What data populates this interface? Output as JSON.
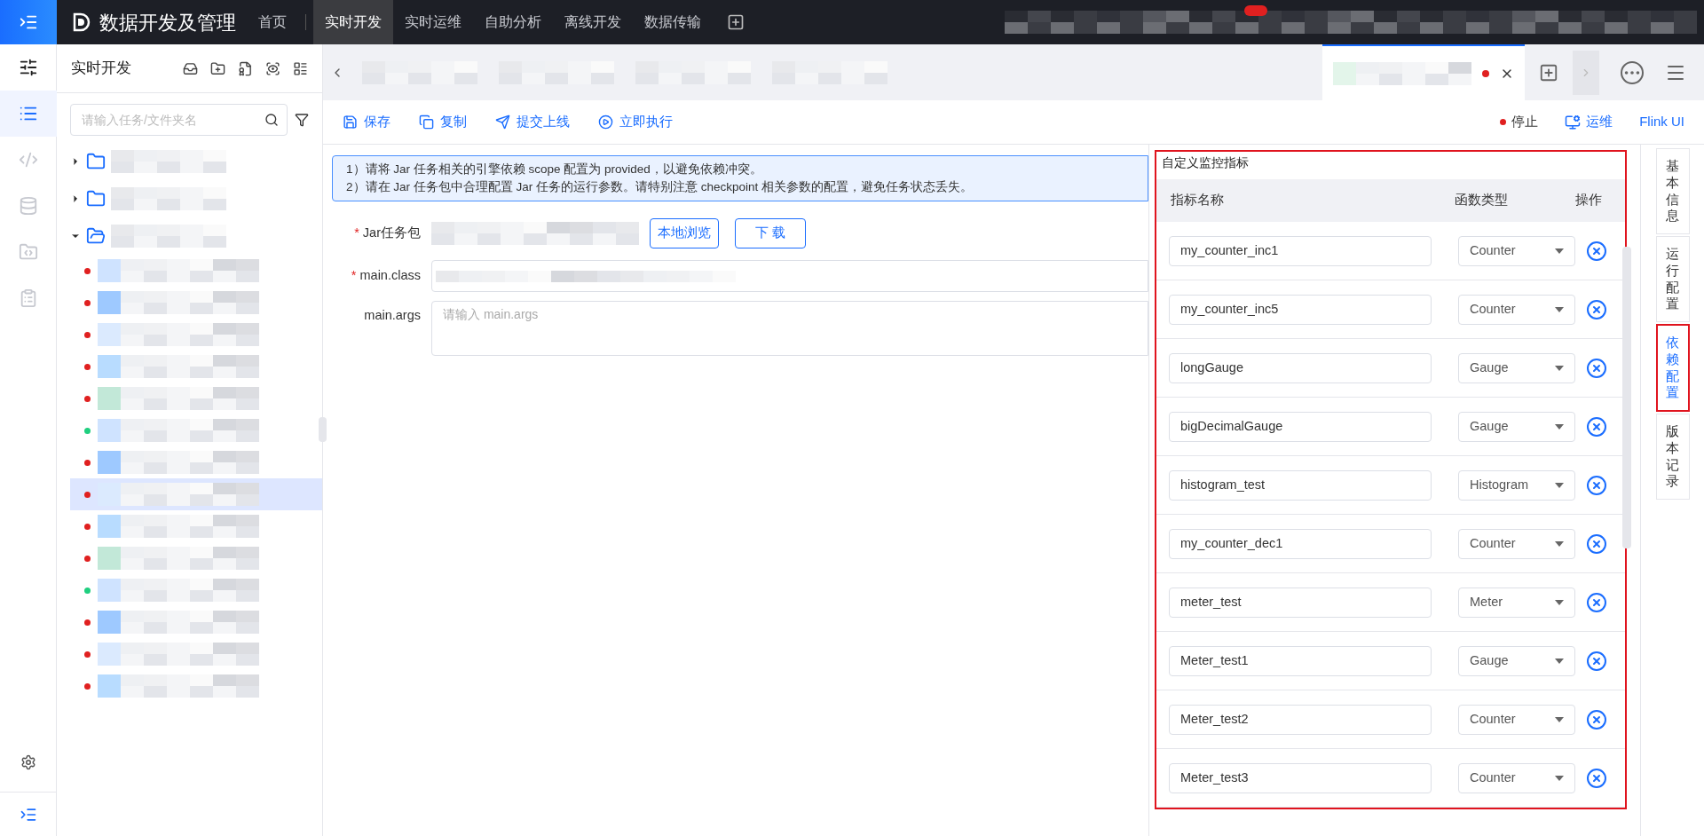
{
  "app": {
    "title": "数据开发及管理"
  },
  "top_nav": [
    {
      "label": "首页",
      "selected": false
    },
    {
      "label": "实时开发",
      "selected": true
    },
    {
      "label": "实时运维",
      "selected": false
    },
    {
      "label": "自助分析",
      "selected": false
    },
    {
      "label": "离线开发",
      "selected": false
    },
    {
      "label": "数据传输",
      "selected": false
    }
  ],
  "side_rail": [
    {
      "kind": "overview",
      "selected": false
    },
    {
      "kind": "list",
      "selected": true
    },
    {
      "kind": "code",
      "selected": false
    },
    {
      "kind": "database",
      "selected": false
    },
    {
      "kind": "folder",
      "selected": false
    },
    {
      "kind": "clipboard",
      "selected": false
    }
  ],
  "tree_panel": {
    "title": "实时开发",
    "search": {
      "placeholder": "请输入任务/文件夹名"
    },
    "folders": [
      {
        "expanded": false
      },
      {
        "expanded": false
      },
      {
        "expanded": true,
        "children": [
          {
            "color": "#e02020",
            "selected": false
          },
          {
            "color": "#e02020",
            "selected": false
          },
          {
            "color": "#e02020",
            "selected": false
          },
          {
            "color": "#e02020",
            "selected": false
          },
          {
            "color": "#e02020",
            "selected": false
          },
          {
            "color": "#1fcf7f",
            "selected": false
          },
          {
            "color": "#e02020",
            "selected": false
          },
          {
            "color": "#e02020",
            "selected": true
          },
          {
            "color": "#e02020",
            "selected": false
          },
          {
            "color": "#e02020",
            "selected": false
          },
          {
            "color": "#1fcf7f",
            "selected": false
          },
          {
            "color": "#e02020",
            "selected": false
          },
          {
            "color": "#e02020",
            "selected": false
          },
          {
            "color": "#e02020",
            "selected": false
          }
        ]
      }
    ]
  },
  "editor_tabs": [
    {
      "selected": false,
      "modified": false
    },
    {
      "selected": false,
      "modified": false
    },
    {
      "selected": false,
      "modified": false
    },
    {
      "selected": false,
      "modified": false
    },
    {
      "selected": true,
      "modified": true
    }
  ],
  "toolbar": {
    "actions": [
      {
        "kind": "save",
        "label": "保存"
      },
      {
        "kind": "copy",
        "label": "复制"
      },
      {
        "kind": "submit",
        "label": "提交上线"
      },
      {
        "kind": "run",
        "label": "立即执行"
      }
    ],
    "status": {
      "label": "停止",
      "color": "#e02020"
    },
    "ops": "运维",
    "flink": "Flink UI"
  },
  "notice": [
    "1）请将 Jar 任务相关的引擎依赖 scope 配置为 provided，以避免依赖冲突。",
    "2）请在 Jar 任务包中合理配置 Jar 任务的运行参数。请特别注意 checkpoint 相关参数的配置，避免任务状态丢失。"
  ],
  "form": {
    "required_mark": "*",
    "jar": {
      "label": "Jar任务包",
      "required": true,
      "browse": "本地浏览",
      "download": "下 载"
    },
    "main_class": {
      "label": "main.class",
      "required": true
    },
    "main_args": {
      "label": "main.args",
      "required": false,
      "placeholder": "请输入 main.args"
    }
  },
  "metrics": {
    "title": "自定义监控指标",
    "highlighted": true,
    "columns": [
      "指标名称",
      "函数类型",
      "操作"
    ],
    "rows": [
      {
        "name": "my_counter_inc1",
        "type": "Counter"
      },
      {
        "name": "my_counter_inc5",
        "type": "Counter"
      },
      {
        "name": "longGauge",
        "type": "Gauge"
      },
      {
        "name": "bigDecimalGauge",
        "type": "Gauge"
      },
      {
        "name": "histogram_test",
        "type": "Histogram"
      },
      {
        "name": "my_counter_dec1",
        "type": "Counter"
      },
      {
        "name": "meter_test",
        "type": "Meter"
      },
      {
        "name": "Meter_test1",
        "type": "Gauge"
      },
      {
        "name": "Meter_test2",
        "type": "Counter"
      },
      {
        "name": "Meter_test3",
        "type": "Counter"
      }
    ]
  },
  "side_tabs": [
    {
      "label": "基本信息",
      "selected": false,
      "highlighted": false
    },
    {
      "label": "运行配置",
      "selected": false,
      "highlighted": false
    },
    {
      "label": "依赖配置",
      "selected": true,
      "highlighted": true
    },
    {
      "label": "版本记录",
      "selected": false,
      "highlighted": false
    }
  ]
}
